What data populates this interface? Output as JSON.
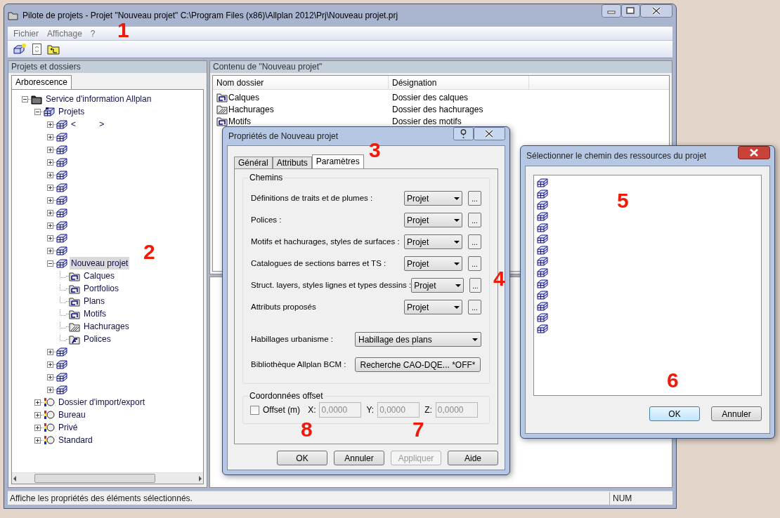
{
  "window": {
    "title": "Pilote de projets - Projet \"Nouveau projet\" C:\\Program Files (x86)\\Allplan 2012\\Prj\\Nouveau projet.prj"
  },
  "menu": [
    "Fichier",
    "Affichage",
    "?"
  ],
  "left_pane": {
    "title": "Projets et dossiers",
    "tabs": [
      {
        "label": "Arborescence",
        "selected": true
      }
    ],
    "tree": [
      {
        "label": "Service d'information Allplan",
        "kind": "root",
        "expanded": true,
        "selected": false,
        "children": [
          {
            "label": "Projets",
            "kind": "projects",
            "expanded": true,
            "selected": false,
            "children": [
              {
                "label": "<          >",
                "kind": "project",
                "expanded": false,
                "selected": false
              },
              {
                "kind": "project",
                "expanded": false,
                "selected": false
              },
              {
                "kind": "project",
                "expanded": false,
                "selected": false
              },
              {
                "kind": "project",
                "expanded": false,
                "selected": false
              },
              {
                "kind": "project",
                "expanded": false,
                "selected": false
              },
              {
                "kind": "project",
                "expanded": false,
                "selected": false
              },
              {
                "kind": "project",
                "expanded": false,
                "selected": false
              },
              {
                "kind": "project",
                "expanded": false,
                "selected": false
              },
              {
                "kind": "project",
                "expanded": false,
                "selected": false
              },
              {
                "kind": "project",
                "expanded": false,
                "selected": false
              },
              {
                "kind": "project",
                "expanded": false,
                "selected": false
              },
              {
                "label": "Nouveau projet",
                "kind": "project",
                "expanded": true,
                "selected": true,
                "children": [
                  {
                    "label": "Calques",
                    "kind": "folder",
                    "selected": false
                  },
                  {
                    "label": "Portfolios",
                    "kind": "folder",
                    "selected": false
                  },
                  {
                    "label": "Plans",
                    "kind": "folder",
                    "selected": false
                  },
                  {
                    "label": "Motifs",
                    "kind": "folder",
                    "selected": false
                  },
                  {
                    "label": "Hachurages",
                    "kind": "hatch",
                    "selected": false
                  },
                  {
                    "label": "Polices",
                    "kind": "font",
                    "selected": false
                  }
                ]
              },
              {
                "kind": "project",
                "expanded": false,
                "selected": false
              },
              {
                "kind": "project",
                "expanded": false,
                "selected": false
              },
              {
                "kind": "project",
                "expanded": false,
                "selected": false
              },
              {
                "kind": "project",
                "expanded": false,
                "selected": false
              }
            ]
          },
          {
            "label": "Dossier d'import/export",
            "kind": "special",
            "expanded": false,
            "selected": false
          },
          {
            "label": "Bureau",
            "kind": "special",
            "expanded": false,
            "selected": false
          },
          {
            "label": "Privé",
            "kind": "special",
            "expanded": false,
            "selected": false
          },
          {
            "label": "Standard",
            "kind": "special",
            "expanded": false,
            "selected": false
          }
        ]
      }
    ]
  },
  "right_pane": {
    "title": "Contenu de \"Nouveau projet\"",
    "columns": [
      "Nom dossier",
      "Désignation"
    ],
    "rows": [
      {
        "name": "Calques",
        "kind": "folder",
        "description": "Dossier des calques"
      },
      {
        "name": "Hachurages",
        "kind": "hatch",
        "description": "Dossier des hachurages"
      },
      {
        "name": "Motifs",
        "kind": "folder",
        "description": "Dossier des motifs"
      }
    ]
  },
  "status_bar": {
    "message": "Affiche les propriétés des éléments sélectionnés.",
    "indicator": "NUM"
  },
  "properties_dialog": {
    "title": "Propriétés de Nouveau projet",
    "tabs": [
      {
        "label": "Général",
        "selected": false
      },
      {
        "label": "Attributs",
        "selected": false
      },
      {
        "label": "Paramètres",
        "selected": true
      }
    ],
    "paths_group": "Chemins",
    "paths": [
      {
        "label": "Définitions de traits et de plumes :",
        "value": "Projet",
        "button": "..."
      },
      {
        "label": "Polices :",
        "value": "Projet",
        "button": "..."
      },
      {
        "label": "Motifs et hachurages, styles de surfaces :",
        "value": "Projet",
        "button": "..."
      },
      {
        "label": "Catalogues de sections barres et TS :",
        "value": "Projet",
        "button": "..."
      },
      {
        "label": "Struct. layers, styles lignes et types dessins :",
        "value": "Projet",
        "button": "..."
      },
      {
        "label": "Attributs proposés",
        "value": "Projet",
        "button": "..."
      }
    ],
    "urban": {
      "label": "Habillages urbanisme :",
      "value": "Habillage des plans"
    },
    "bcm": {
      "label": "Bibliothèque Allplan BCM :",
      "button": "Recherche CAO-DQE... *OFF*"
    },
    "offset_group": "Coordonnées offset",
    "offset": {
      "label": "Offset (m)",
      "checked": false
    },
    "coords": [
      {
        "label": "X:",
        "value": "0,0000",
        "disabled": true
      },
      {
        "label": "Y:",
        "value": "0,0000",
        "disabled": true
      },
      {
        "label": "Z:",
        "value": "0,0000",
        "disabled": true
      }
    ],
    "buttons": [
      {
        "label": "OK",
        "disabled": false
      },
      {
        "label": "Annuler",
        "disabled": false
      },
      {
        "label": "Appliquer",
        "disabled": true
      },
      {
        "label": "Aide",
        "disabled": false
      }
    ]
  },
  "path_dialog": {
    "title": "Sélectionner le chemin des ressources du projet",
    "item_count_icons": [
      {
        "kind": "project"
      },
      {
        "kind": "project"
      },
      {
        "kind": "project"
      },
      {
        "kind": "project"
      },
      {
        "kind": "project"
      },
      {
        "kind": "project"
      },
      {
        "kind": "project"
      },
      {
        "kind": "project"
      },
      {
        "kind": "project"
      },
      {
        "kind": "project"
      },
      {
        "kind": "project"
      },
      {
        "kind": "project"
      },
      {
        "kind": "project"
      },
      {
        "kind": "project"
      }
    ],
    "buttons": [
      {
        "label": "OK",
        "default": true
      },
      {
        "label": "Annuler",
        "default": false
      }
    ]
  },
  "annotations": [
    "1",
    "2",
    "3",
    "4",
    "5",
    "6",
    "7",
    "8"
  ]
}
